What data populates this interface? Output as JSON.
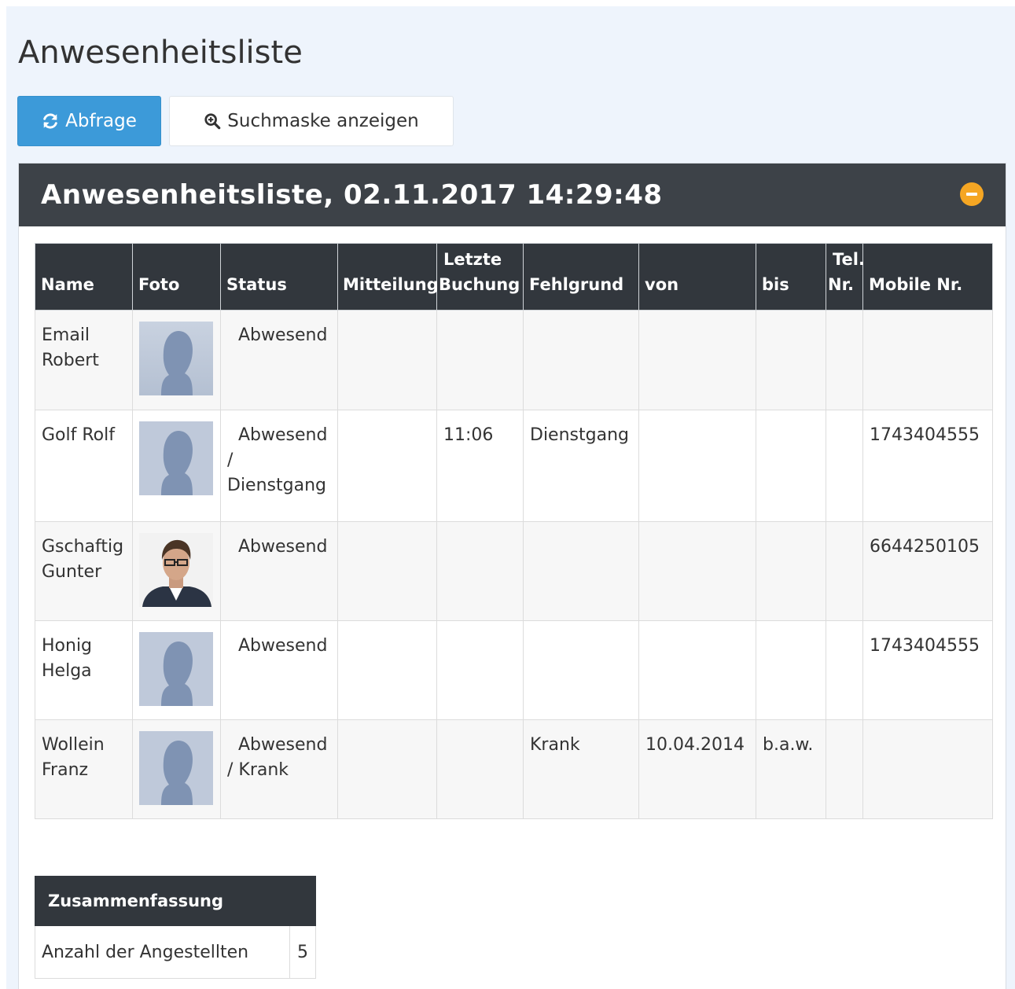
{
  "page": {
    "title": "Anwesenheitsliste"
  },
  "toolbar": {
    "query_label": "Abfrage",
    "search_mask_label": "Suchmaske anzeigen"
  },
  "panel": {
    "title": "Anwesenheitsliste, 02.11.2017 14:29:48"
  },
  "table": {
    "headers": {
      "name": "Name",
      "foto": "Foto",
      "status": "Status",
      "mitteilung": "Mitteilung",
      "letzte_buchung_1": "Letzte",
      "letzte_buchung_2": "Buchung",
      "fehlgrund": "Fehlgrund",
      "von": "von",
      "bis": "bis",
      "tel_1": "Tel.",
      "tel_2": "Nr.",
      "mobile": "Mobile Nr."
    },
    "rows": [
      {
        "name": "Email Robert",
        "photo": "placeholder-silhouette",
        "status": "Abwesend",
        "mitteilung": "",
        "letzte_buchung": "",
        "fehlgrund": "",
        "von": "",
        "bis": "",
        "tel": "",
        "mobile": ""
      },
      {
        "name": "Golf Rolf",
        "photo": "placeholder-silhouette",
        "status": "Abwesend / Dienstgang",
        "mitteilung": "",
        "letzte_buchung": "11:06",
        "fehlgrund": "Dienstgang",
        "von": "",
        "bis": "",
        "tel": "",
        "mobile": "1743404555"
      },
      {
        "name": "Gschaftig Gunter",
        "photo": "person-photo",
        "status": "Abwesend",
        "mitteilung": "",
        "letzte_buchung": "",
        "fehlgrund": "",
        "von": "",
        "bis": "",
        "tel": "",
        "mobile": "6644250105"
      },
      {
        "name": "Honig Helga",
        "photo": "placeholder-silhouette",
        "status": "Abwesend",
        "mitteilung": "",
        "letzte_buchung": "",
        "fehlgrund": "",
        "von": "",
        "bis": "",
        "tel": "",
        "mobile": "1743404555"
      },
      {
        "name": "Wollein Franz",
        "photo": "placeholder-silhouette",
        "status": "Abwesend / Krank",
        "mitteilung": "",
        "letzte_buchung": "",
        "fehlgrund": "Krank",
        "von": "10.04.2014",
        "bis": "b.a.w.",
        "tel": "",
        "mobile": ""
      }
    ]
  },
  "summary": {
    "header": "Zusammenfassung",
    "label": "Anzahl der Angestellten",
    "value": "5"
  },
  "colors": {
    "primary_button": "#3c9ad9",
    "panel_header": "#3d4248",
    "table_header": "#32373d",
    "collapse_icon": "#f5a623",
    "page_background": "#eef4fc"
  }
}
